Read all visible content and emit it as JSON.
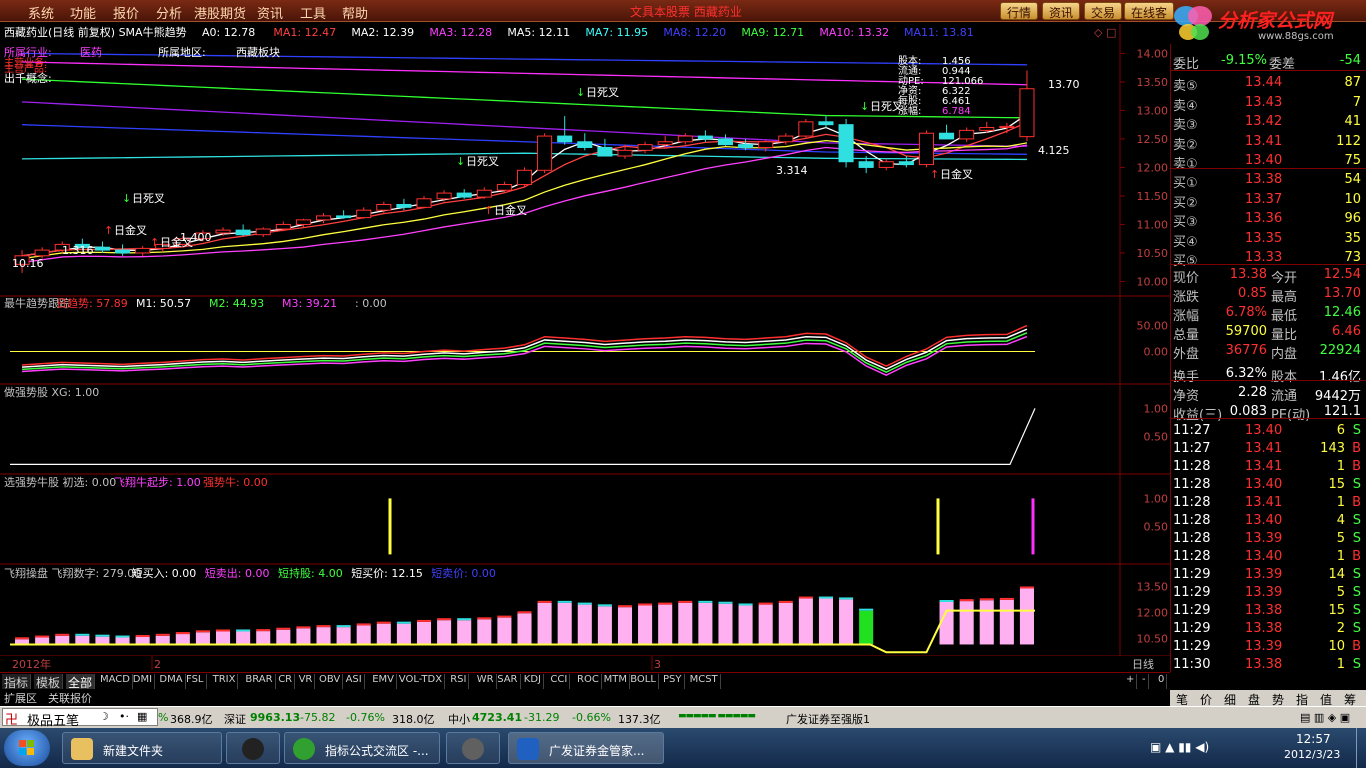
{
  "menubar": {
    "items": [
      "系统",
      "功能",
      "报价",
      "分析",
      "港股期货",
      "资讯",
      "工具",
      "帮助"
    ],
    "title": "文具本股票 西藏药业",
    "right_tabs": [
      "行情",
      "资讯",
      "交易",
      "在线客"
    ]
  },
  "brand": {
    "name": "分析家公式网",
    "url": "www.88gs.com"
  },
  "main_header": {
    "name": "西藏药业(日线 前复权) SMA牛熊趋势",
    "ma": [
      {
        "label": "A0: 12.78",
        "color": "#ffffff"
      },
      {
        "label": "MA1: 12.47",
        "color": "#ff4040"
      },
      {
        "label": "MA2: 12.39",
        "color": "#ffffff"
      },
      {
        "label": "MA3: 12.28",
        "color": "#ff40ff"
      },
      {
        "label": "MA5: 12.11",
        "color": "#ffffff"
      },
      {
        "label": "MA7: 11.95",
        "color": "#40ffff"
      },
      {
        "label": "MA8: 12.20",
        "color": "#4040ff"
      },
      {
        "label": "MA9: 12.71",
        "color": "#40ff40"
      },
      {
        "label": "MA10: 13.32",
        "color": "#ff40ff"
      },
      {
        "label": "MA11: 13.81",
        "color": "#4040ff"
      }
    ]
  },
  "stock_info": {
    "industry_label": "所属行业:",
    "industry": "医药",
    "region_label": "所属地区:",
    "region": "西藏板块",
    "line2": "主营业务:",
    "line3": "主营产品:",
    "line4": "出千概念:"
  },
  "overlay_stats": [
    {
      "label": "股本:",
      "value": "1.456"
    },
    {
      "label": "流通:",
      "value": "0.944"
    },
    {
      "label": "动PE:",
      "value": "121.066"
    },
    {
      "label": "净资:",
      "value": "6.322"
    },
    {
      "label": "每股:",
      "value": "6.461"
    },
    {
      "label": "涨幅:",
      "value": "6.784"
    }
  ],
  "chart_data": [
    {
      "type": "candlestick",
      "title": "西藏药业(日线 前复权)",
      "yticks": [
        "14.00",
        "13.50",
        "13.00",
        "12.50",
        "12.00",
        "11.50",
        "11.00",
        "10.50",
        "10.00"
      ],
      "ylim": [
        9.85,
        14.2
      ],
      "price_labels": [
        "13.70",
        "4.125",
        "3.314",
        "1.400",
        "1.316",
        "10.16"
      ],
      "annotations": [
        "日死叉",
        "日死叉",
        "日死叉",
        "日死叉",
        "日金叉",
        "日金叉",
        "日金叉",
        "日金叉"
      ],
      "ohlc": [
        [
          10.3,
          10.55,
          10.15,
          10.45
        ],
        [
          10.45,
          10.6,
          10.4,
          10.55
        ],
        [
          10.55,
          10.7,
          10.5,
          10.65
        ],
        [
          10.65,
          10.75,
          10.55,
          10.6
        ],
        [
          10.6,
          10.7,
          10.5,
          10.55
        ],
        [
          10.55,
          10.65,
          10.45,
          10.5
        ],
        [
          10.5,
          10.62,
          10.45,
          10.58
        ],
        [
          10.58,
          10.7,
          10.52,
          10.65
        ],
        [
          10.65,
          10.8,
          10.6,
          10.75
        ],
        [
          10.75,
          10.9,
          10.7,
          10.85
        ],
        [
          10.85,
          10.95,
          10.8,
          10.9
        ],
        [
          10.9,
          11.0,
          10.8,
          10.82
        ],
        [
          10.82,
          10.95,
          10.78,
          10.92
        ],
        [
          10.92,
          11.05,
          10.88,
          11.0
        ],
        [
          11.0,
          11.1,
          10.95,
          11.08
        ],
        [
          11.08,
          11.2,
          11.02,
          11.15
        ],
        [
          11.15,
          11.25,
          11.1,
          11.12
        ],
        [
          11.12,
          11.3,
          11.1,
          11.25
        ],
        [
          11.25,
          11.4,
          11.2,
          11.35
        ],
        [
          11.35,
          11.45,
          11.25,
          11.3
        ],
        [
          11.3,
          11.5,
          11.28,
          11.45
        ],
        [
          11.45,
          11.6,
          11.4,
          11.55
        ],
        [
          11.55,
          11.62,
          11.45,
          11.48
        ],
        [
          11.48,
          11.65,
          11.45,
          11.6
        ],
        [
          11.6,
          11.75,
          11.55,
          11.7
        ],
        [
          11.7,
          12.0,
          11.65,
          11.95
        ],
        [
          11.95,
          12.6,
          11.9,
          12.55
        ],
        [
          12.55,
          12.9,
          12.4,
          12.45
        ],
        [
          12.45,
          12.6,
          12.3,
          12.35
        ],
        [
          12.35,
          12.5,
          12.25,
          12.2
        ],
        [
          12.2,
          12.4,
          12.15,
          12.3
        ],
        [
          12.3,
          12.45,
          12.25,
          12.4
        ],
        [
          12.4,
          12.55,
          12.35,
          12.45
        ],
        [
          12.45,
          12.6,
          12.4,
          12.55
        ],
        [
          12.55,
          12.65,
          12.45,
          12.5
        ],
        [
          12.5,
          12.58,
          12.38,
          12.4
        ],
        [
          12.4,
          12.5,
          12.3,
          12.35
        ],
        [
          12.35,
          12.48,
          12.28,
          12.45
        ],
        [
          12.45,
          12.6,
          12.4,
          12.55
        ],
        [
          12.55,
          12.85,
          12.5,
          12.8
        ],
        [
          12.8,
          12.9,
          12.7,
          12.75
        ],
        [
          12.75,
          12.85,
          12.0,
          12.1
        ],
        [
          12.1,
          12.2,
          11.9,
          12.0
        ],
        [
          12.0,
          12.15,
          11.95,
          12.1
        ],
        [
          12.1,
          12.2,
          12.0,
          12.05
        ],
        [
          12.05,
          12.65,
          12.0,
          12.6
        ],
        [
          12.6,
          12.75,
          12.5,
          12.5
        ],
        [
          12.5,
          12.7,
          12.45,
          12.65
        ],
        [
          12.65,
          12.8,
          12.6,
          12.7
        ],
        [
          12.7,
          12.78,
          12.6,
          12.72
        ],
        [
          12.54,
          13.7,
          12.46,
          13.38
        ]
      ]
    },
    {
      "type": "line",
      "title": "最牛趋势跟踪",
      "labels": [
        {
          "text": "最牛趋势跟踪",
          "color": "#c0c0c0"
        },
        {
          "text": "日趋势: 57.89",
          "color": "#ff3030"
        },
        {
          "text": "M1: 50.57",
          "color": "#ffffff"
        },
        {
          "text": "M2: 44.93",
          "color": "#40ff40"
        },
        {
          "text": "M3: 39.21",
          "color": "#ff40ff"
        },
        {
          "text": ": 0.00",
          "color": "#c0c0c0"
        }
      ],
      "yticks": [
        "50.00",
        "0.00"
      ],
      "ylim": [
        -55,
        80
      ]
    },
    {
      "type": "line",
      "title": "做强势股",
      "labels": [
        {
          "text": "做强势股 XG: 1.00",
          "color": "#c0c0c0"
        }
      ],
      "yticks": [
        "1.00",
        "0.50"
      ],
      "ylim": [
        -0.1,
        1.15
      ]
    },
    {
      "type": "bar",
      "title": "选强势牛股",
      "labels": [
        {
          "text": "选强势牛股 初选: 0.00",
          "color": "#c0c0c0"
        },
        {
          "text": "飞翔牛起步: 1.00",
          "color": "#ff40ff"
        },
        {
          "text": "强势牛: 0.00",
          "color": "#ff3030"
        }
      ],
      "yticks": [
        "1.00",
        "0.50"
      ],
      "ylim": [
        -0.1,
        1.15
      ]
    },
    {
      "type": "bar",
      "title": "飞翔操盘",
      "labels": [
        {
          "text": "飞翔操盘 飞翔数字: 279.00",
          "color": "#c0c0c0"
        },
        {
          "text": "短买入: 0.00",
          "color": "#ffffff"
        },
        {
          "text": "短卖出: 0.00",
          "color": "#ff40ff"
        },
        {
          "text": "短持股: 4.00",
          "color": "#40ff40"
        },
        {
          "text": "短买价: 12.15",
          "color": "#ffffff"
        },
        {
          "text": "短卖价: 0.00",
          "color": "#4040ff"
        }
      ],
      "yticks": [
        "13.50",
        "12.00",
        "10.50"
      ],
      "ylim": [
        9.6,
        14.1
      ]
    }
  ],
  "x_axis": {
    "labels": [
      "2012年",
      "2",
      "3"
    ],
    "period": "日线"
  },
  "indicator_tabs": [
    "指标",
    "模板",
    "全部",
    "MACD",
    "DMI",
    "DMA",
    "FSL",
    "TRIX",
    "BRAR",
    "CR",
    "VR",
    "OBV",
    "ASI",
    "EMV",
    "VOL-TDX",
    "RSI",
    "WR",
    "SAR",
    "KDJ",
    "CCI",
    "ROC",
    "MTM",
    "BOLL",
    "PSY",
    "MCST"
  ],
  "sub_tabs": [
    "扩展区",
    "关联报价"
  ],
  "quote": {
    "header": {
      "label": "委比",
      "value": "-9.15%",
      "label2": "委差",
      "value2": "-54"
    },
    "sells": [
      {
        "label": "卖⑤",
        "price": "13.44",
        "vol": "87"
      },
      {
        "label": "卖④",
        "price": "13.43",
        "vol": "7"
      },
      {
        "label": "卖③",
        "price": "13.42",
        "vol": "41"
      },
      {
        "label": "卖②",
        "price": "13.41",
        "vol": "112"
      },
      {
        "label": "卖①",
        "price": "13.40",
        "vol": "75"
      }
    ],
    "buys": [
      {
        "label": "买①",
        "price": "13.38",
        "vol": "54"
      },
      {
        "label": "买②",
        "price": "13.37",
        "vol": "10"
      },
      {
        "label": "买③",
        "price": "13.36",
        "vol": "96"
      },
      {
        "label": "买④",
        "price": "13.35",
        "vol": "35"
      },
      {
        "label": "买⑤",
        "price": "13.33",
        "vol": "73"
      }
    ],
    "stats": [
      {
        "l1": "现价",
        "v1": "13.38",
        "c1": "#ff3030",
        "l2": "今开",
        "v2": "12.54",
        "c2": "#ff3030"
      },
      {
        "l1": "涨跌",
        "v1": "0.85",
        "c1": "#ff3030",
        "l2": "最高",
        "v2": "13.70",
        "c2": "#ff3030"
      },
      {
        "l1": "涨幅",
        "v1": "6.78%",
        "c1": "#ff3030",
        "l2": "最低",
        "v2": "12.46",
        "c2": "#40ff40"
      },
      {
        "l1": "总量",
        "v1": "59700",
        "c1": "#ffff40",
        "l2": "量比",
        "v2": "6.46",
        "c2": "#ff3030"
      },
      {
        "l1": "外盘",
        "v1": "36776",
        "c1": "#ff3030",
        "l2": "内盘",
        "v2": "22924",
        "c2": "#40ff40"
      },
      {
        "l1": "换手",
        "v1": "6.32%",
        "c1": "#ffffff",
        "l2": "股本",
        "v2": "1.46亿",
        "c2": "#ffffff"
      },
      {
        "l1": "净资",
        "v1": "2.28",
        "c1": "#ffffff",
        "l2": "流通",
        "v2": "9442万",
        "c2": "#ffffff"
      },
      {
        "l1": "收益(三)",
        "v1": "0.083",
        "c1": "#ffffff",
        "l2": "PE(动)",
        "v2": "121.1",
        "c2": "#ffffff"
      }
    ],
    "ticks": [
      {
        "time": "11:27",
        "price": "13.40",
        "vol": "6",
        "side": "S"
      },
      {
        "time": "11:27",
        "price": "13.41",
        "vol": "143",
        "side": "B"
      },
      {
        "time": "11:28",
        "price": "13.41",
        "vol": "1",
        "side": "B"
      },
      {
        "time": "11:28",
        "price": "13.40",
        "vol": "15",
        "side": "S"
      },
      {
        "time": "11:28",
        "price": "13.41",
        "vol": "1",
        "side": "B"
      },
      {
        "time": "11:28",
        "price": "13.40",
        "vol": "4",
        "side": "S"
      },
      {
        "time": "11:28",
        "price": "13.39",
        "vol": "5",
        "side": "S"
      },
      {
        "time": "11:28",
        "price": "13.40",
        "vol": "1",
        "side": "B"
      },
      {
        "time": "11:29",
        "price": "13.39",
        "vol": "14",
        "side": "S"
      },
      {
        "time": "11:29",
        "price": "13.39",
        "vol": "5",
        "side": "S"
      },
      {
        "time": "11:29",
        "price": "13.38",
        "vol": "15",
        "side": "S"
      },
      {
        "time": "11:29",
        "price": "13.38",
        "vol": "2",
        "side": "S"
      },
      {
        "time": "11:29",
        "price": "13.39",
        "vol": "10",
        "side": "B"
      },
      {
        "time": "11:30",
        "price": "13.38",
        "vol": "1",
        "side": "S"
      }
    ]
  },
  "right_tabs": [
    "笔",
    "价",
    "细",
    "盘",
    "势",
    "指",
    "值",
    "筹"
  ],
  "statusbar": {
    "app": "极品五笔",
    "amount1": "368.9亿",
    "sz_label": "深证",
    "sz_val": "9963.13",
    "sz_chg": "-75.82",
    "sz_pct": "-0.76%",
    "sz_amt": "318.0亿",
    "zx_label": "中小",
    "zx_val": "4723.41",
    "zx_chg": "-31.29",
    "zx_pct": "-0.66%",
    "zx_amt": "137.3亿",
    "broker": "广发证券至强版1"
  },
  "taskbar": {
    "items": [
      "新建文件夹",
      "",
      "指标公式交流区 -...",
      "",
      "广发证券金管家..."
    ],
    "time": "12:57",
    "date": "2012/3/23"
  }
}
